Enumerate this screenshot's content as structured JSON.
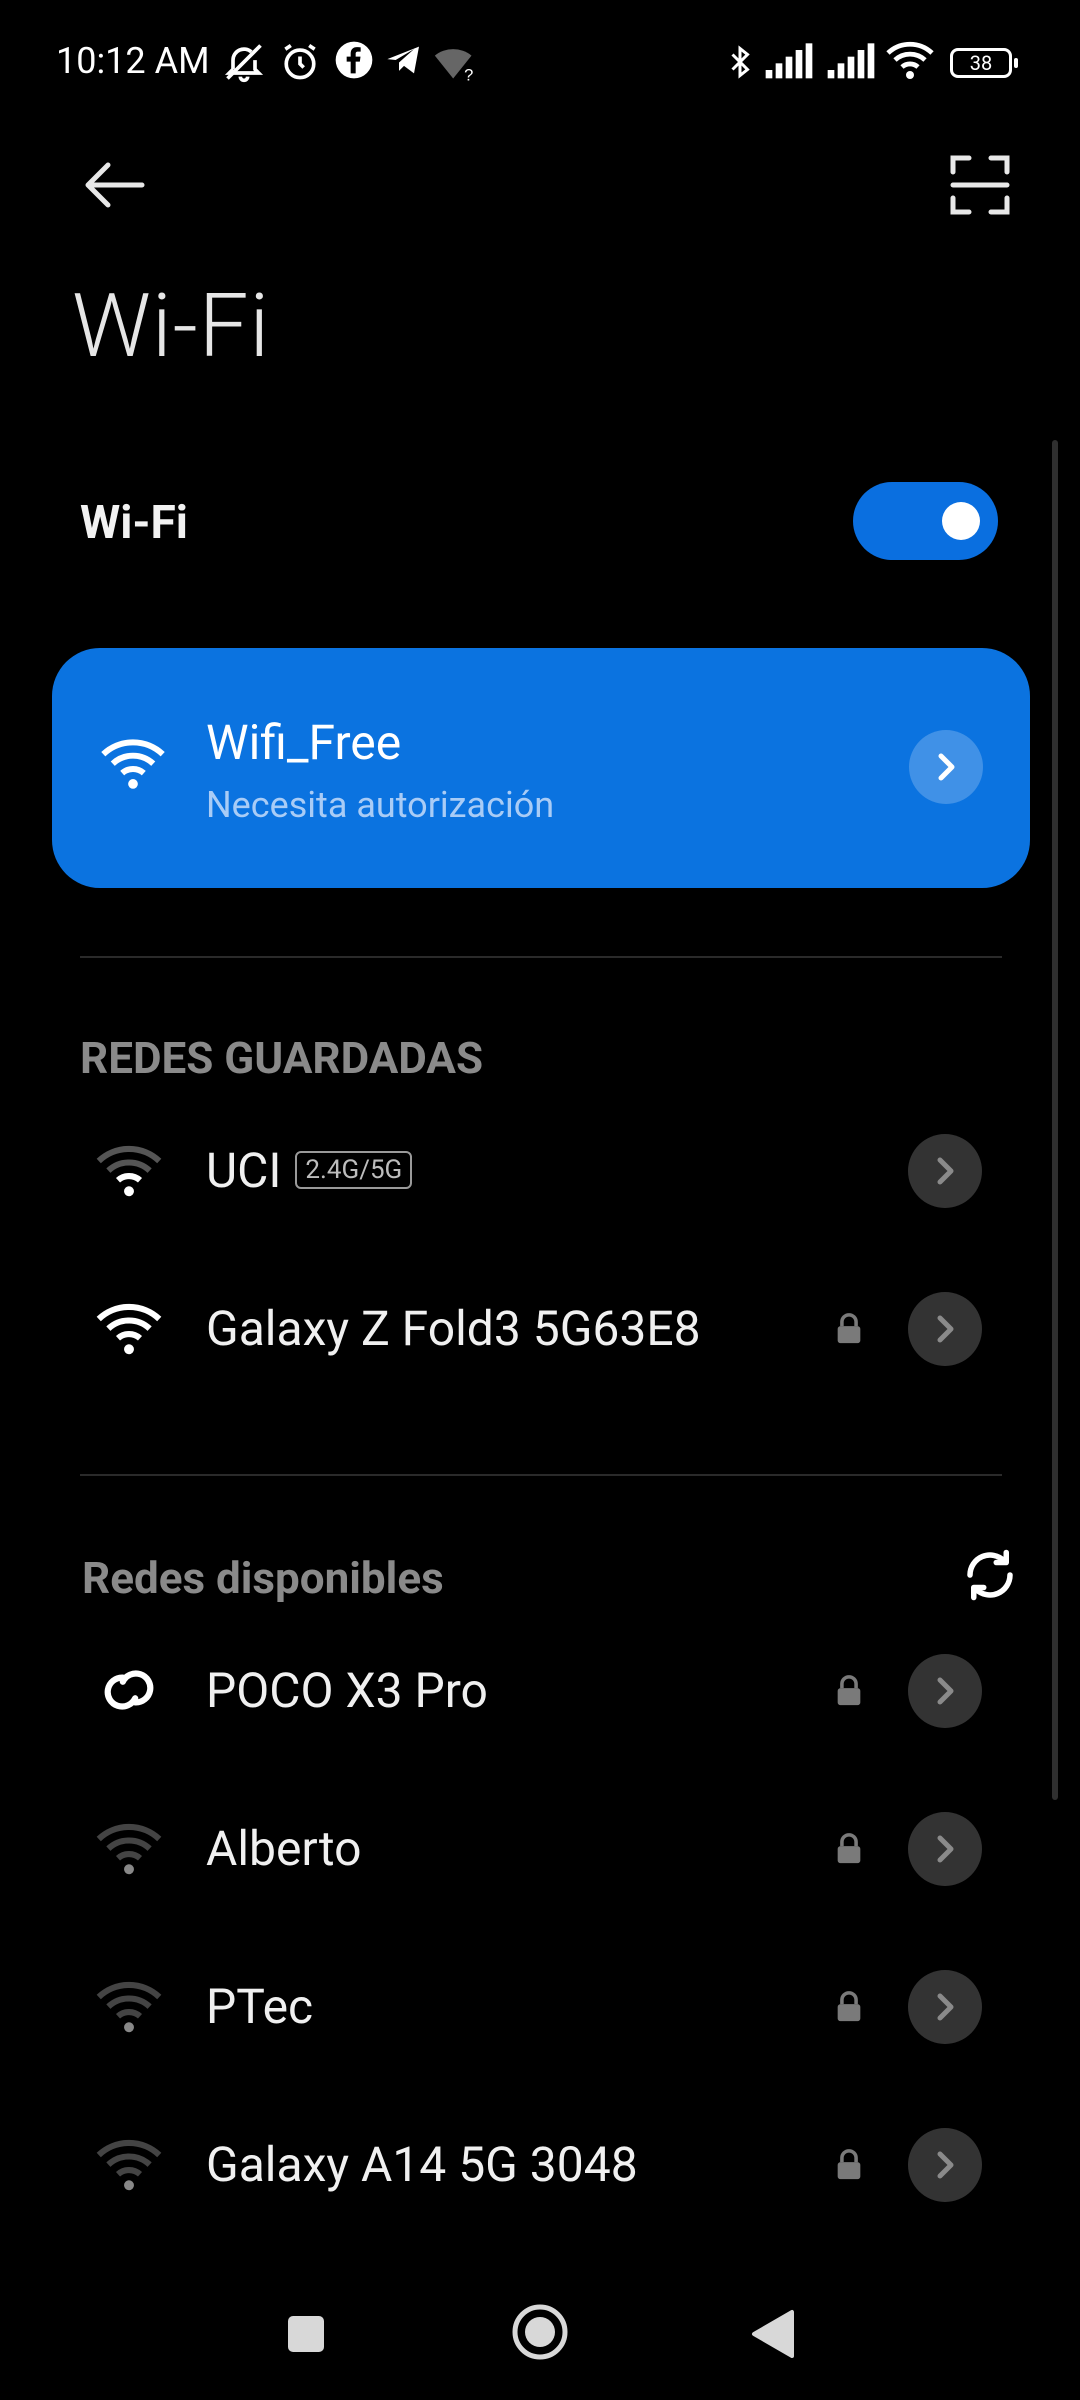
{
  "status_bar": {
    "time": "10:12 AM",
    "battery": "38",
    "icons": [
      "bell-off-icon",
      "alarm-icon",
      "facebook-icon",
      "telegram-icon",
      "wifi-unknown-icon",
      "bluetooth-icon",
      "signal-icon",
      "signal-icon",
      "wifi-icon",
      "battery-icon"
    ]
  },
  "header": {
    "title": "Wi-Fi"
  },
  "wifi_toggle": {
    "label": "Wi-Fi",
    "enabled": true
  },
  "connected_network": {
    "name": "Wifi_Free",
    "status": "Necesita autorización"
  },
  "saved_networks": {
    "heading": "REDES GUARDADAS",
    "items": [
      {
        "name": "UCI",
        "badge": "2.4G/5G",
        "secured": false,
        "signal": "weak"
      },
      {
        "name": "Galaxy Z Fold3 5G63E8",
        "secured": true,
        "signal": "strong"
      }
    ]
  },
  "available_networks": {
    "heading": "Redes disponibles",
    "items": [
      {
        "name": "POCO X3 Pro",
        "secured": true,
        "icon": "hotspot-link-icon"
      },
      {
        "name": "Alberto",
        "secured": true,
        "signal": "weak"
      },
      {
        "name": "PTec",
        "secured": true,
        "signal": "weak"
      },
      {
        "name": "Galaxy A14 5G 3048",
        "secured": true,
        "signal": "weak"
      }
    ]
  },
  "colors": {
    "accent": "#0b73e0",
    "background": "#000000",
    "chevron_bg": "#333333"
  }
}
